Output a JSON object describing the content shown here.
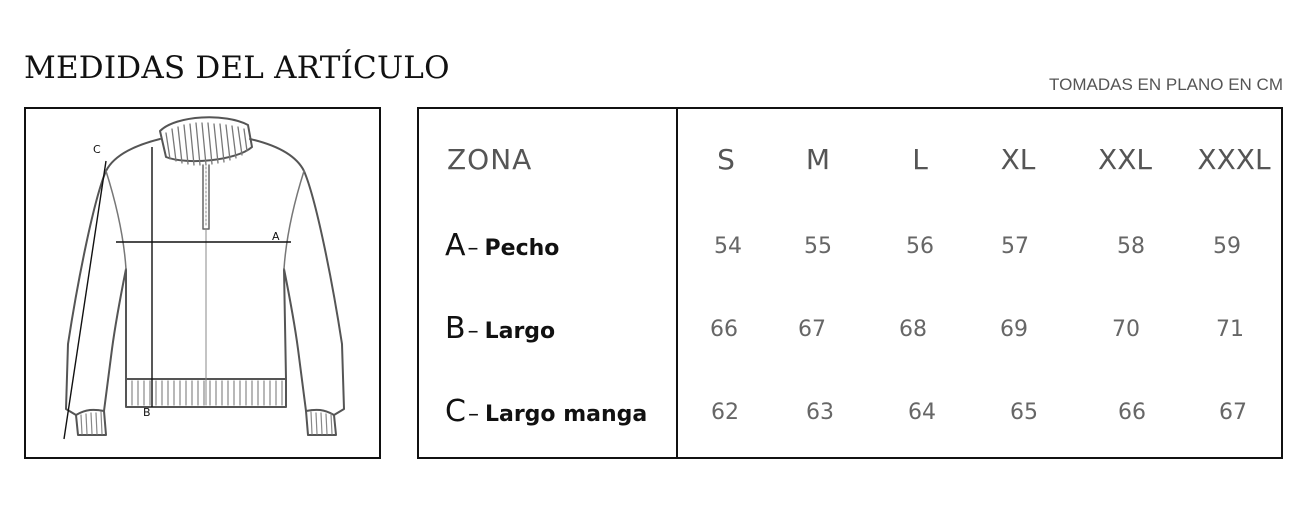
{
  "title": "MEDIDAS DEL ARTÍCULO",
  "subtitle": "TOMADAS EN PLANO EN CM",
  "diagram": {
    "label_a": "A",
    "label_b": "B",
    "label_c": "C"
  },
  "table": {
    "zona_label": "ZONA",
    "sizes": [
      "S",
      "M",
      "L",
      "XL",
      "XXL",
      "XXXL"
    ],
    "rows": [
      {
        "letter": "A",
        "dash": "–",
        "name": "Pecho",
        "values": [
          "54",
          "55",
          "56",
          "57",
          "58",
          "59"
        ]
      },
      {
        "letter": "B",
        "dash": "–",
        "name": "Largo",
        "values": [
          "66",
          "67",
          "68",
          "69",
          "70",
          "71"
        ]
      },
      {
        "letter": "C",
        "dash": "–",
        "name": "Largo manga",
        "values": [
          "62",
          "63",
          "64",
          "65",
          "66",
          "67"
        ]
      }
    ]
  }
}
